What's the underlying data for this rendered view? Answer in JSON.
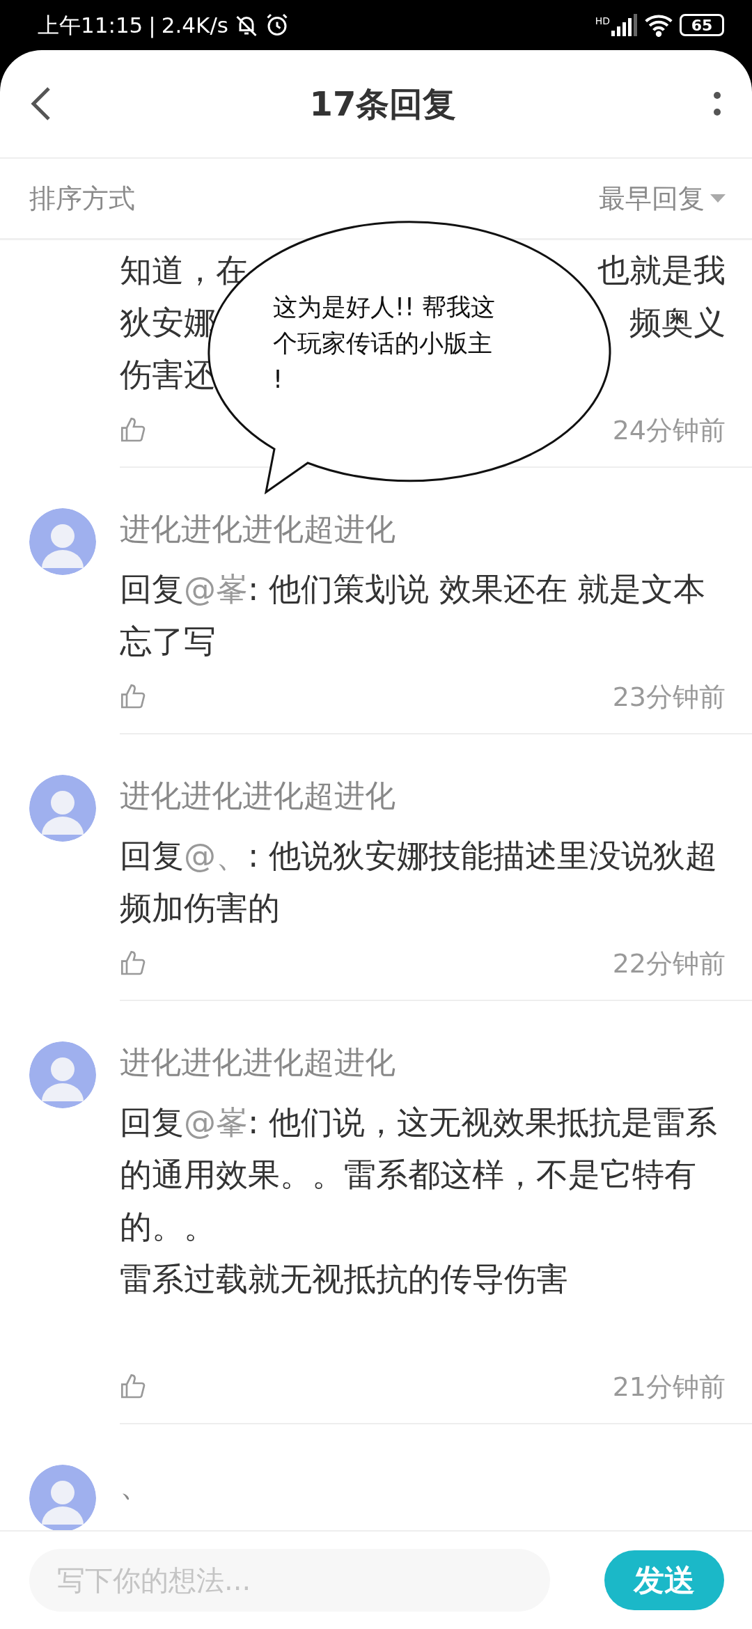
{
  "status_bar": {
    "time": "上午11:15",
    "separator": "|",
    "speed": "2.4K/s",
    "network": "HD",
    "battery": "65"
  },
  "header": {
    "title": "17条回复"
  },
  "sort": {
    "label": "排序方式",
    "value": "最早回复"
  },
  "comments": [
    {
      "kind": "partial",
      "lines": [
        {
          "left": "知道，在",
          "right": "也就是我"
        },
        {
          "left": "狄安娜",
          "right": "频奥义"
        },
        {
          "left": "伤害还"
        }
      ],
      "time": "24分钟前"
    },
    {
      "kind": "reply",
      "author": "进化进化进化超进化",
      "prefix": "回复",
      "mention": "@峯",
      "paragraphs": [
        ": 他们策划说 效果还在 就是文本忘了写"
      ],
      "time": "23分钟前"
    },
    {
      "kind": "reply",
      "author": "进化进化进化超进化",
      "prefix": "回复",
      "mention": "@、",
      "paragraphs": [
        ": 他说狄安娜技能描述里没说狄超频加伤害的"
      ],
      "time": "22分钟前"
    },
    {
      "kind": "reply",
      "author": "进化进化进化超进化",
      "prefix": "回复",
      "mention": "@峯",
      "paragraphs": [
        ": 他们说，这无视效果抵抗是雷系的通用效果。。雷系都这样，不是它特有的。。",
        "雷系过载就无视抵抗的传导伤害"
      ],
      "trailing_blank": true,
      "time": "21分钟前"
    },
    {
      "kind": "cut",
      "author": "、"
    }
  ],
  "bubble": {
    "lines": [
      "这为是好人!! 帮我这",
      "个玩家传话的小版主",
      "!"
    ]
  },
  "composer": {
    "placeholder": "写下你的想法...",
    "send": "发送"
  }
}
